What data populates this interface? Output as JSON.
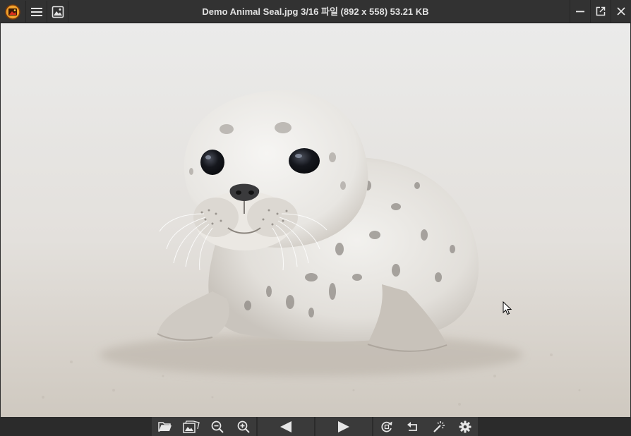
{
  "window": {
    "title": "Demo Animal Seal.jpg 3/16 파일 (892 x 558) 53.21 KB"
  },
  "titlebar": {
    "icons": [
      "app-logo-icon",
      "hamburger-menu-icon",
      "gallery-icon"
    ],
    "window_buttons": [
      "minimize-icon",
      "popout-icon",
      "close-icon"
    ]
  },
  "image": {
    "subject": "seal"
  },
  "toolbar": {
    "tools": [
      "open-folder-icon",
      "slideshow-icon",
      "zoom-out-icon",
      "zoom-in-icon",
      "previous-icon",
      "next-icon",
      "rotate-icon",
      "undo-icon",
      "magic-wand-icon",
      "settings-gear-icon"
    ]
  },
  "colors": {
    "titlebar_bg": "#323232",
    "toolbar_bg": "#3a3a3a",
    "icon": "#e6e6e6",
    "title_text": "#e0e0e0"
  }
}
